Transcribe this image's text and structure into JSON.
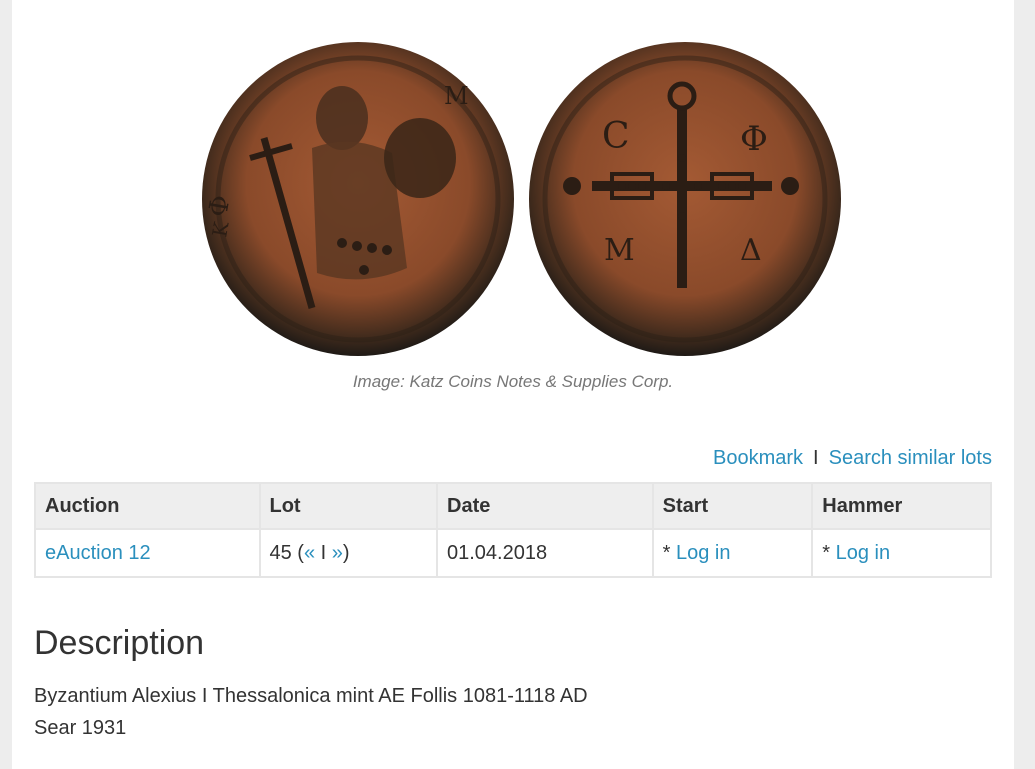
{
  "image": {
    "caption": "Image: Katz Coins Notes & Supplies Corp.",
    "obverse_letters": [
      "Φ",
      "K",
      "M"
    ],
    "reverse_letters": [
      "C",
      "Φ",
      "M",
      "Δ"
    ]
  },
  "actions": {
    "bookmark": "Bookmark",
    "separator": "I",
    "search_similar": "Search similar lots"
  },
  "table": {
    "headers": {
      "auction": "Auction",
      "lot": "Lot",
      "date": "Date",
      "start": "Start",
      "hammer": "Hammer"
    },
    "row": {
      "auction": "eAuction 12",
      "lot_number": "45 (",
      "prev": "«",
      "lot_sep": " I ",
      "next": "»",
      "lot_close": ")",
      "date": "01.04.2018",
      "start_prefix": "* ",
      "start_link": "Log in",
      "hammer_prefix": "* ",
      "hammer_link": "Log in"
    }
  },
  "description": {
    "title": "Description",
    "lines": [
      "Byzantium Alexius I Thessalonica mint AE Follis 1081-1118 AD",
      "Sear 1931"
    ]
  }
}
